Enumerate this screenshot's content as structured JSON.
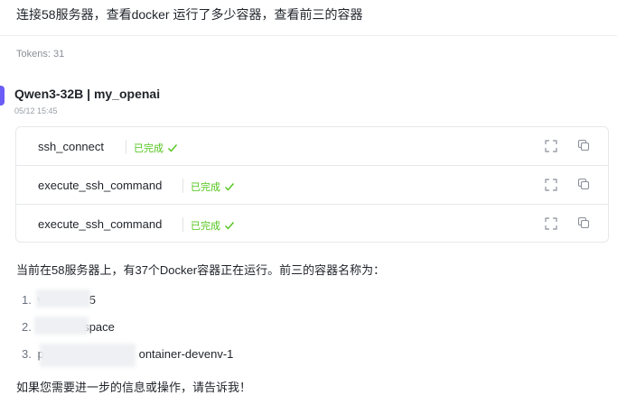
{
  "user_message": "连接58服务器，查看docker 运行了多少容器，查看前三的容器",
  "tokens": "Tokens: 31",
  "model_label": "Qwen3-32B | my_openai",
  "timestamp": "05/12 15:45",
  "tool_calls": [
    {
      "name": "ssh_connect",
      "status": "已完成"
    },
    {
      "name": "execute_ssh_command",
      "status": "已完成"
    },
    {
      "name": "execute_ssh_command",
      "status": "已完成"
    }
  ],
  "answer_intro": "当前在58服务器上，有37个Docker容器正在运行。前三的容器名称为：",
  "containers": [
    {
      "num": "1.",
      "text": "v              5"
    },
    {
      "num": "2.",
      "text": "              space"
    },
    {
      "num": "3.",
      "text": "p                             ontainer-devenv-1"
    }
  ],
  "closing": "如果您需要进一步的信息或操作，请告诉我！",
  "colors": {
    "success": "#52c41a",
    "accent": "#6b5cf6"
  }
}
